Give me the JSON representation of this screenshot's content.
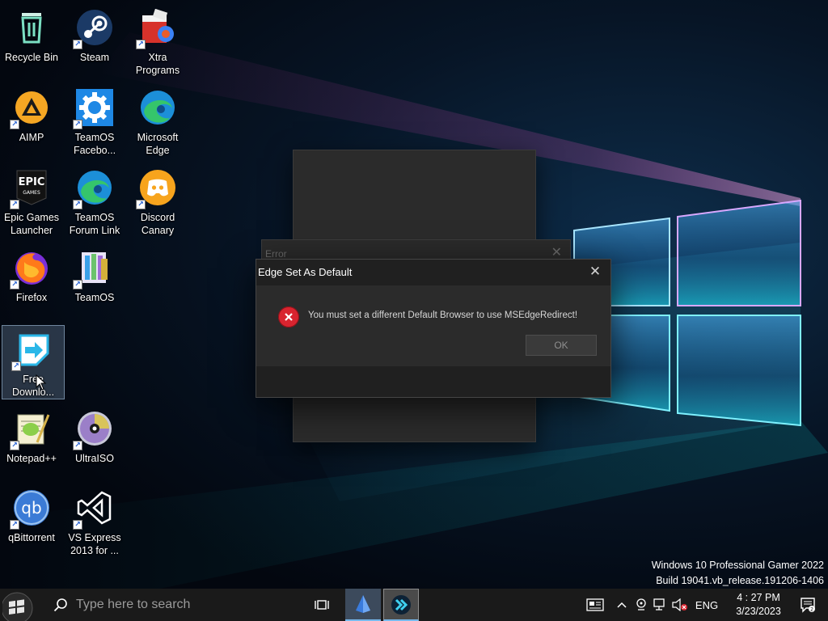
{
  "desktop": {
    "icons": [
      {
        "label": "Recycle Bin",
        "icon": "recycle-bin-icon"
      },
      {
        "label": "Steam",
        "icon": "steam-icon"
      },
      {
        "label": "Xtra\nPrograms",
        "icon": "xtra-programs-icon"
      },
      {
        "label": "AIMP",
        "icon": "aimp-icon"
      },
      {
        "label": "TeamOS\nFacebo...",
        "icon": "settings-gear-icon"
      },
      {
        "label": "Microsoft\nEdge",
        "icon": "edge-icon"
      },
      {
        "label": "Epic Games\nLauncher",
        "icon": "epic-games-icon"
      },
      {
        "label": "TeamOS\nForum Link",
        "icon": "edge-icon"
      },
      {
        "label": "Discord\nCanary",
        "icon": "discord-icon"
      },
      {
        "label": "Firefox",
        "icon": "firefox-icon"
      },
      {
        "label": "TeamOS",
        "icon": "teamos-icon"
      },
      {
        "label": "Free\nDownlo...",
        "icon": "free-download-manager-icon"
      },
      {
        "label": "Notepad++",
        "icon": "notepad-plus-plus-icon"
      },
      {
        "label": "UltraISO",
        "icon": "ultraiso-disc-icon"
      },
      {
        "label": "qBittorrent",
        "icon": "qbittorrent-icon"
      },
      {
        "label": "VS Express\n2013 for ...",
        "icon": "visual-studio-icon"
      }
    ]
  },
  "background_error": {
    "title": "Error",
    "close": "✕"
  },
  "dialog": {
    "title": "Edge Set As Default",
    "close": "✕",
    "message": "You must set a different Default Browser to use MSEdgeRedirect!",
    "ok_label": "OK"
  },
  "watermark": {
    "line1": "Windows 10 Professional Gamer 2022",
    "line2": "Build 19041.vb_release.191206-1406"
  },
  "taskbar": {
    "search_placeholder": "Type here to search",
    "language": "ENG",
    "time": "4 : 27 PM",
    "date": "3/23/2023",
    "accent": "#76b9ed"
  }
}
